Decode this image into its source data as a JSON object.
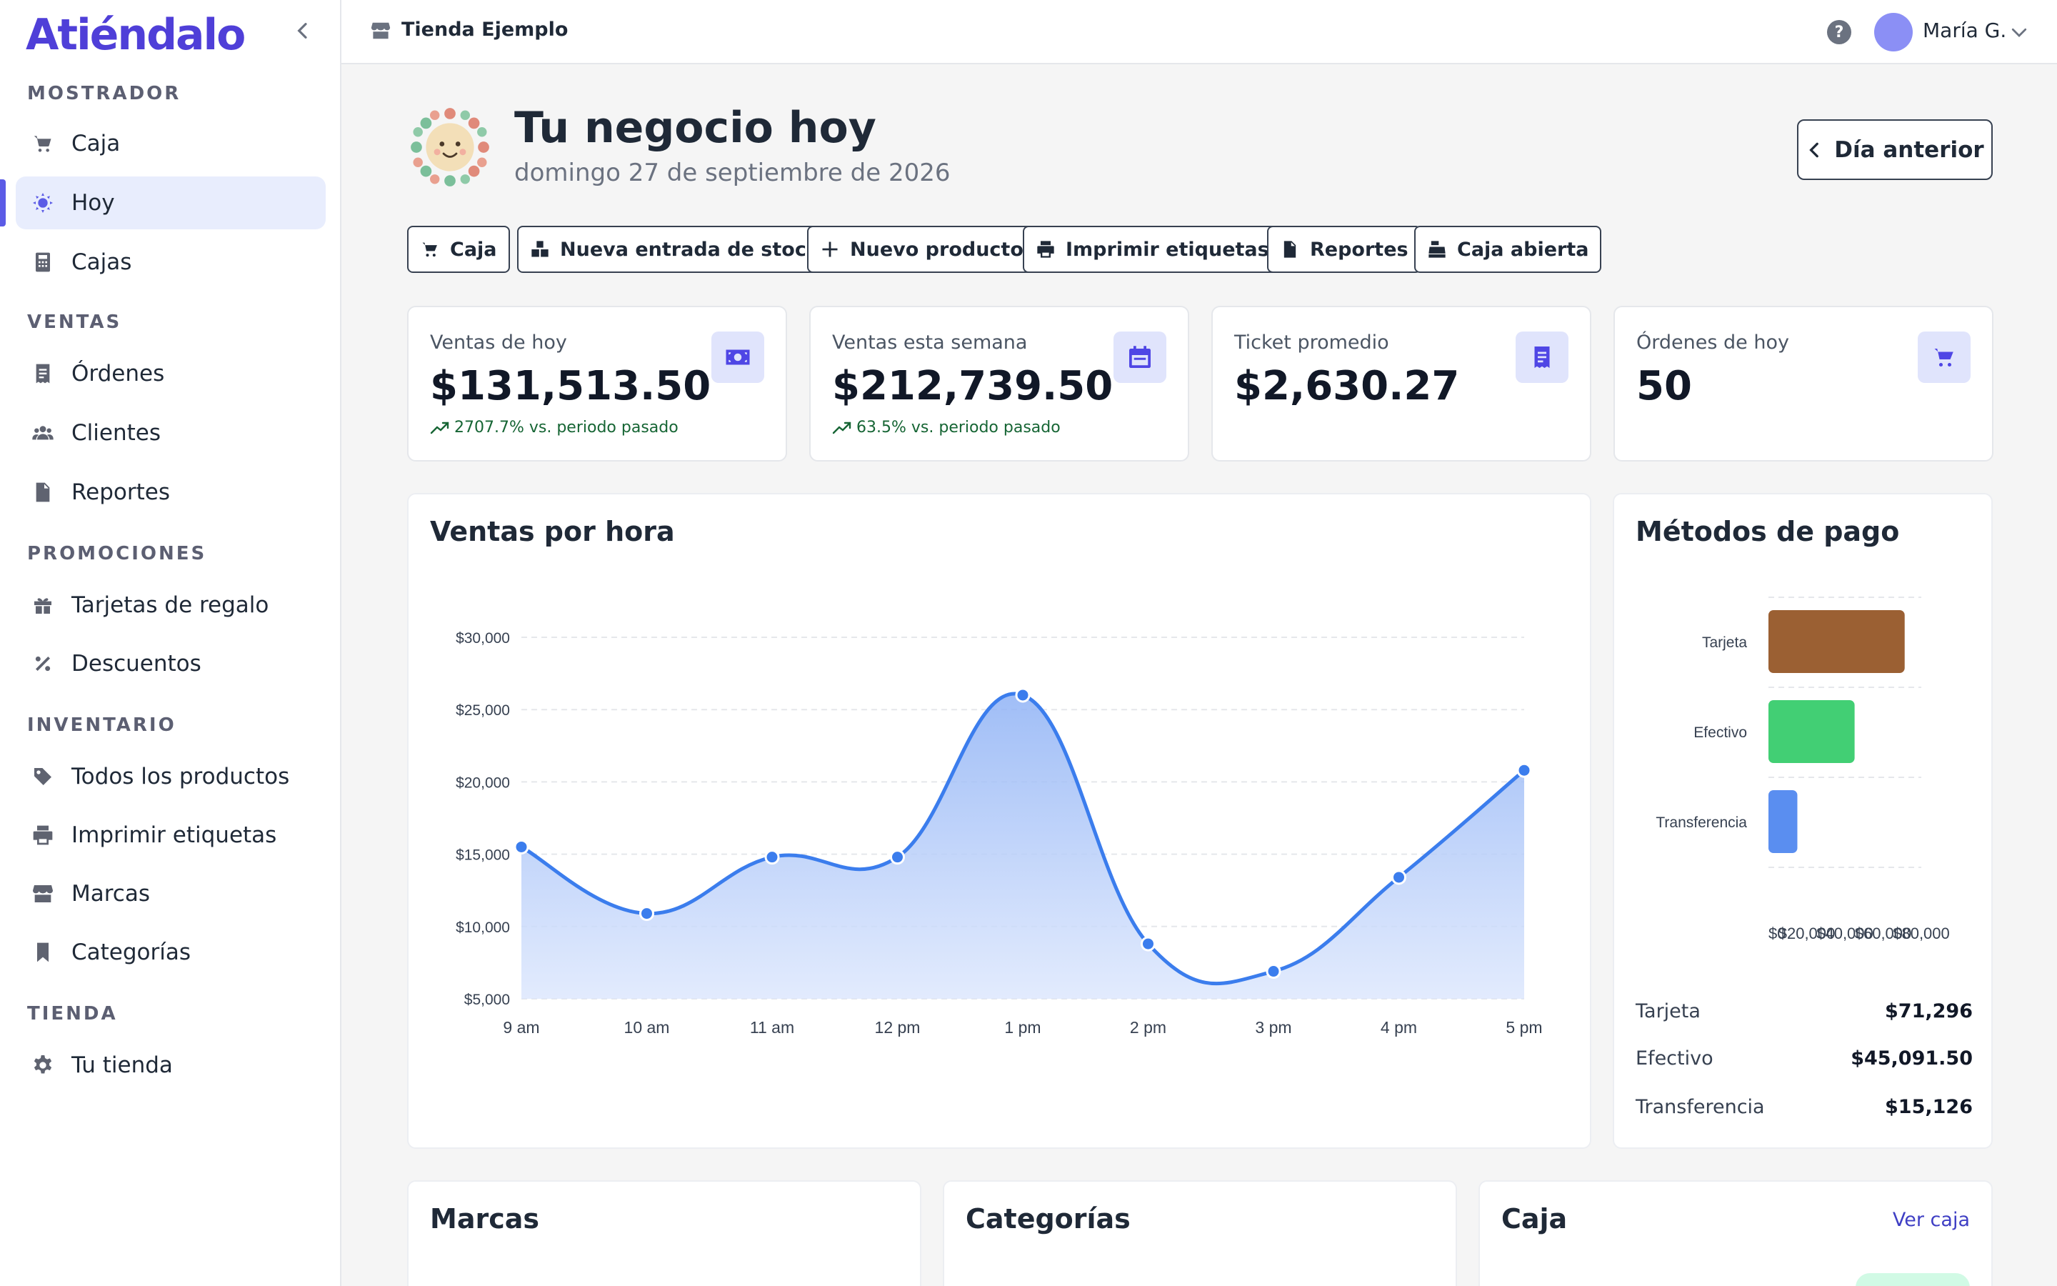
{
  "sidebar": {
    "logo": "Atiéndalo",
    "sections": {
      "mostrador": "MOSTRADOR",
      "ventas": "VENTAS",
      "promociones": "PROMOCIONES",
      "inventario": "INVENTARIO",
      "tienda": "TIENDA"
    },
    "items": {
      "caja": "Caja",
      "hoy": "Hoy",
      "cajas": "Cajas",
      "ordenes": "Órdenes",
      "clientes": "Clientes",
      "reportes": "Reportes",
      "tarjetas": "Tarjetas de regalo",
      "descuentos": "Descuentos",
      "productos": "Todos los productos",
      "etiquetas": "Imprimir etiquetas",
      "marcas": "Marcas",
      "categorias": "Categorías",
      "tu_tienda": "Tu tienda"
    }
  },
  "topbar": {
    "store_name": "Tienda Ejemplo",
    "help": "?",
    "user_name": "María G."
  },
  "header": {
    "title": "Tu negocio hoy",
    "date": "domingo 27 de septiembre de 2026",
    "prev_day": "Día anterior"
  },
  "actions": {
    "caja": "Caja",
    "stock": "Nueva entrada de stock",
    "producto": "Nuevo producto",
    "etiquetas": "Imprimir etiquetas",
    "reportes": "Reportes",
    "caja_abierta": "Caja abierta"
  },
  "stats": [
    {
      "label": "Ventas de hoy",
      "value": "$131,513.50",
      "trend": "2707.7% vs. periodo pasado"
    },
    {
      "label": "Ventas esta semana",
      "value": "$212,739.50",
      "trend": "63.5% vs. periodo pasado"
    },
    {
      "label": "Ticket promedio",
      "value": "$2,630.27"
    },
    {
      "label": "Órdenes de hoy",
      "value": "50"
    }
  ],
  "colors": {
    "accent": "#5b5be6",
    "line": "#3b7ded",
    "tarjeta": "#9b6033",
    "efectivo": "#42cf74",
    "transferencia": "#5a8ef0"
  },
  "chart_data": [
    {
      "type": "area",
      "title": "Ventas por hora",
      "categories": [
        "9 am",
        "10 am",
        "11 am",
        "12 pm",
        "1 pm",
        "2 pm",
        "3 pm",
        "4 pm",
        "5 pm"
      ],
      "values": [
        15500,
        10900,
        14800,
        14800,
        26000,
        8800,
        6900,
        13400,
        20800
      ],
      "ylim": [
        5000,
        30000
      ],
      "yticks": [
        "$5,000",
        "$10,000",
        "$15,000",
        "$20,000",
        "$25,000",
        "$30,000"
      ],
      "ytick_values": [
        5000,
        10000,
        15000,
        20000,
        25000,
        30000
      ],
      "grid": true
    },
    {
      "type": "bar",
      "orientation": "horizontal",
      "title": "Métodos de pago",
      "categories": [
        "Tarjeta",
        "Efectivo",
        "Transferencia"
      ],
      "values": [
        71296,
        45091.5,
        15126
      ],
      "xticks": [
        "$0",
        "$20,000",
        "$40,000",
        "$60,000",
        "$80,000"
      ],
      "xtick_values": [
        0,
        20000,
        40000,
        60000,
        80000
      ],
      "xlim": [
        0,
        80000
      ],
      "grid": true
    }
  ],
  "payments": [
    {
      "label": "Tarjeta",
      "value": "$71,296"
    },
    {
      "label": "Efectivo",
      "value": "$45,091.50"
    },
    {
      "label": "Transferencia",
      "value": "$15,126"
    }
  ],
  "panels": {
    "marcas": "Marcas",
    "categorias": "Categorías",
    "caja": "Caja",
    "ver_caja": "Ver caja"
  }
}
